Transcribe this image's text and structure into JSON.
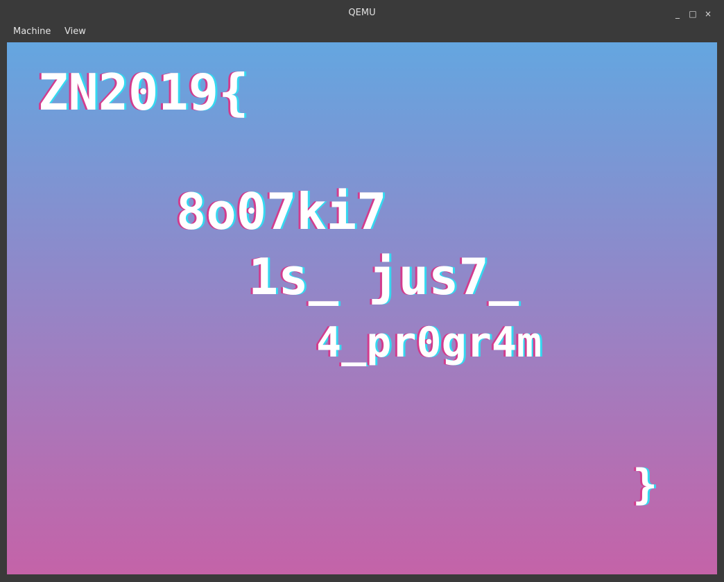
{
  "window": {
    "title": "QEMU",
    "controls": {
      "minimize": "_",
      "maximize": "□",
      "close": "×"
    }
  },
  "menu": {
    "items": [
      "Machine",
      "View"
    ]
  },
  "screen": {
    "lines": [
      "ZN2019{",
      "8o07ki7",
      "1s_ jus7_",
      "4_pr0gr4m",
      "}"
    ]
  }
}
